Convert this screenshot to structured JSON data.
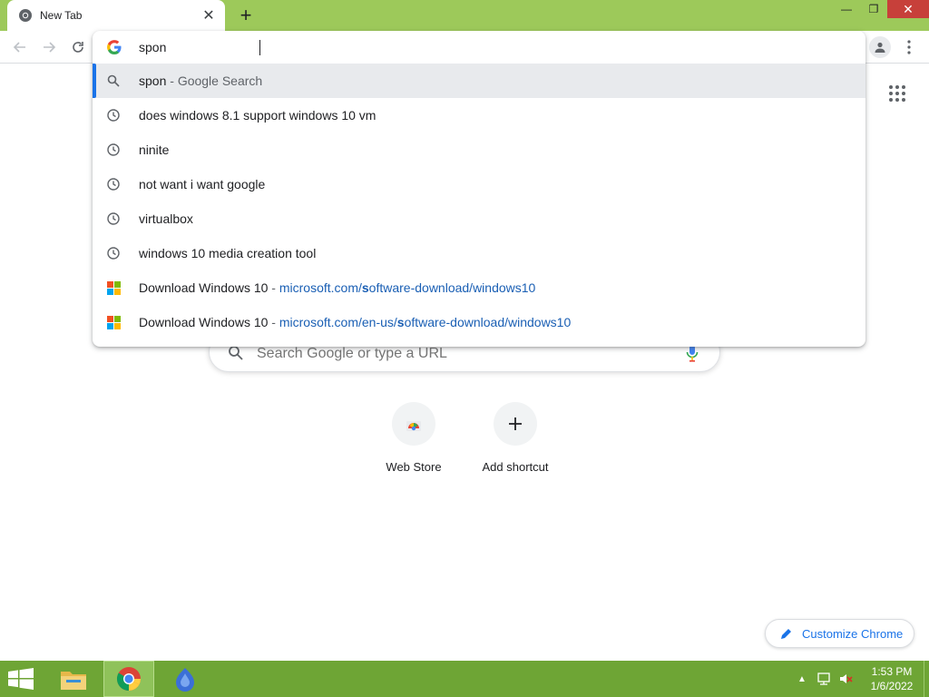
{
  "browser": {
    "tab_title": "New Tab",
    "window_controls": {
      "minimize": "—",
      "restore": "❐",
      "close": "✕"
    }
  },
  "omnibox": {
    "query": "spon",
    "suggestions": [
      {
        "type": "search",
        "icon": "search-icon",
        "text": "spon",
        "suffix": "Google Search"
      },
      {
        "type": "history",
        "icon": "clock-icon",
        "text": "does windows 8.1 support windows 10 vm"
      },
      {
        "type": "history",
        "icon": "clock-icon",
        "text": "ninite"
      },
      {
        "type": "history",
        "icon": "clock-icon",
        "text": "not want i want google"
      },
      {
        "type": "history",
        "icon": "clock-icon",
        "text": "virtualbox"
      },
      {
        "type": "history",
        "icon": "clock-icon",
        "text": "windows 10 media creation tool"
      },
      {
        "type": "url",
        "icon": "microsoft-logo-icon",
        "text": "Download Windows 10",
        "url_pre": "microsoft.com/",
        "url_bold": "s",
        "url_post": "oftware-download/windows10"
      },
      {
        "type": "url",
        "icon": "microsoft-logo-icon",
        "text": "Download Windows 10",
        "url_pre": "microsoft.com/en-us/",
        "url_bold": "s",
        "url_post": "oftware-download/windows10"
      }
    ],
    "separator": " - "
  },
  "ntp": {
    "search_placeholder": "Search Google or type a URL",
    "shortcuts": [
      {
        "label": "Web Store",
        "icon": "web-store-icon"
      },
      {
        "label": "Add shortcut",
        "icon": "plus-icon"
      }
    ],
    "customize_label": "Customize Chrome"
  },
  "taskbar": {
    "time": "1:53 PM",
    "date": "1/6/2022"
  },
  "colors": {
    "titlebar": "#9dc95a",
    "taskbar": "#6ea535",
    "accent": "#1a73e8",
    "url": "#1a5fb4"
  }
}
